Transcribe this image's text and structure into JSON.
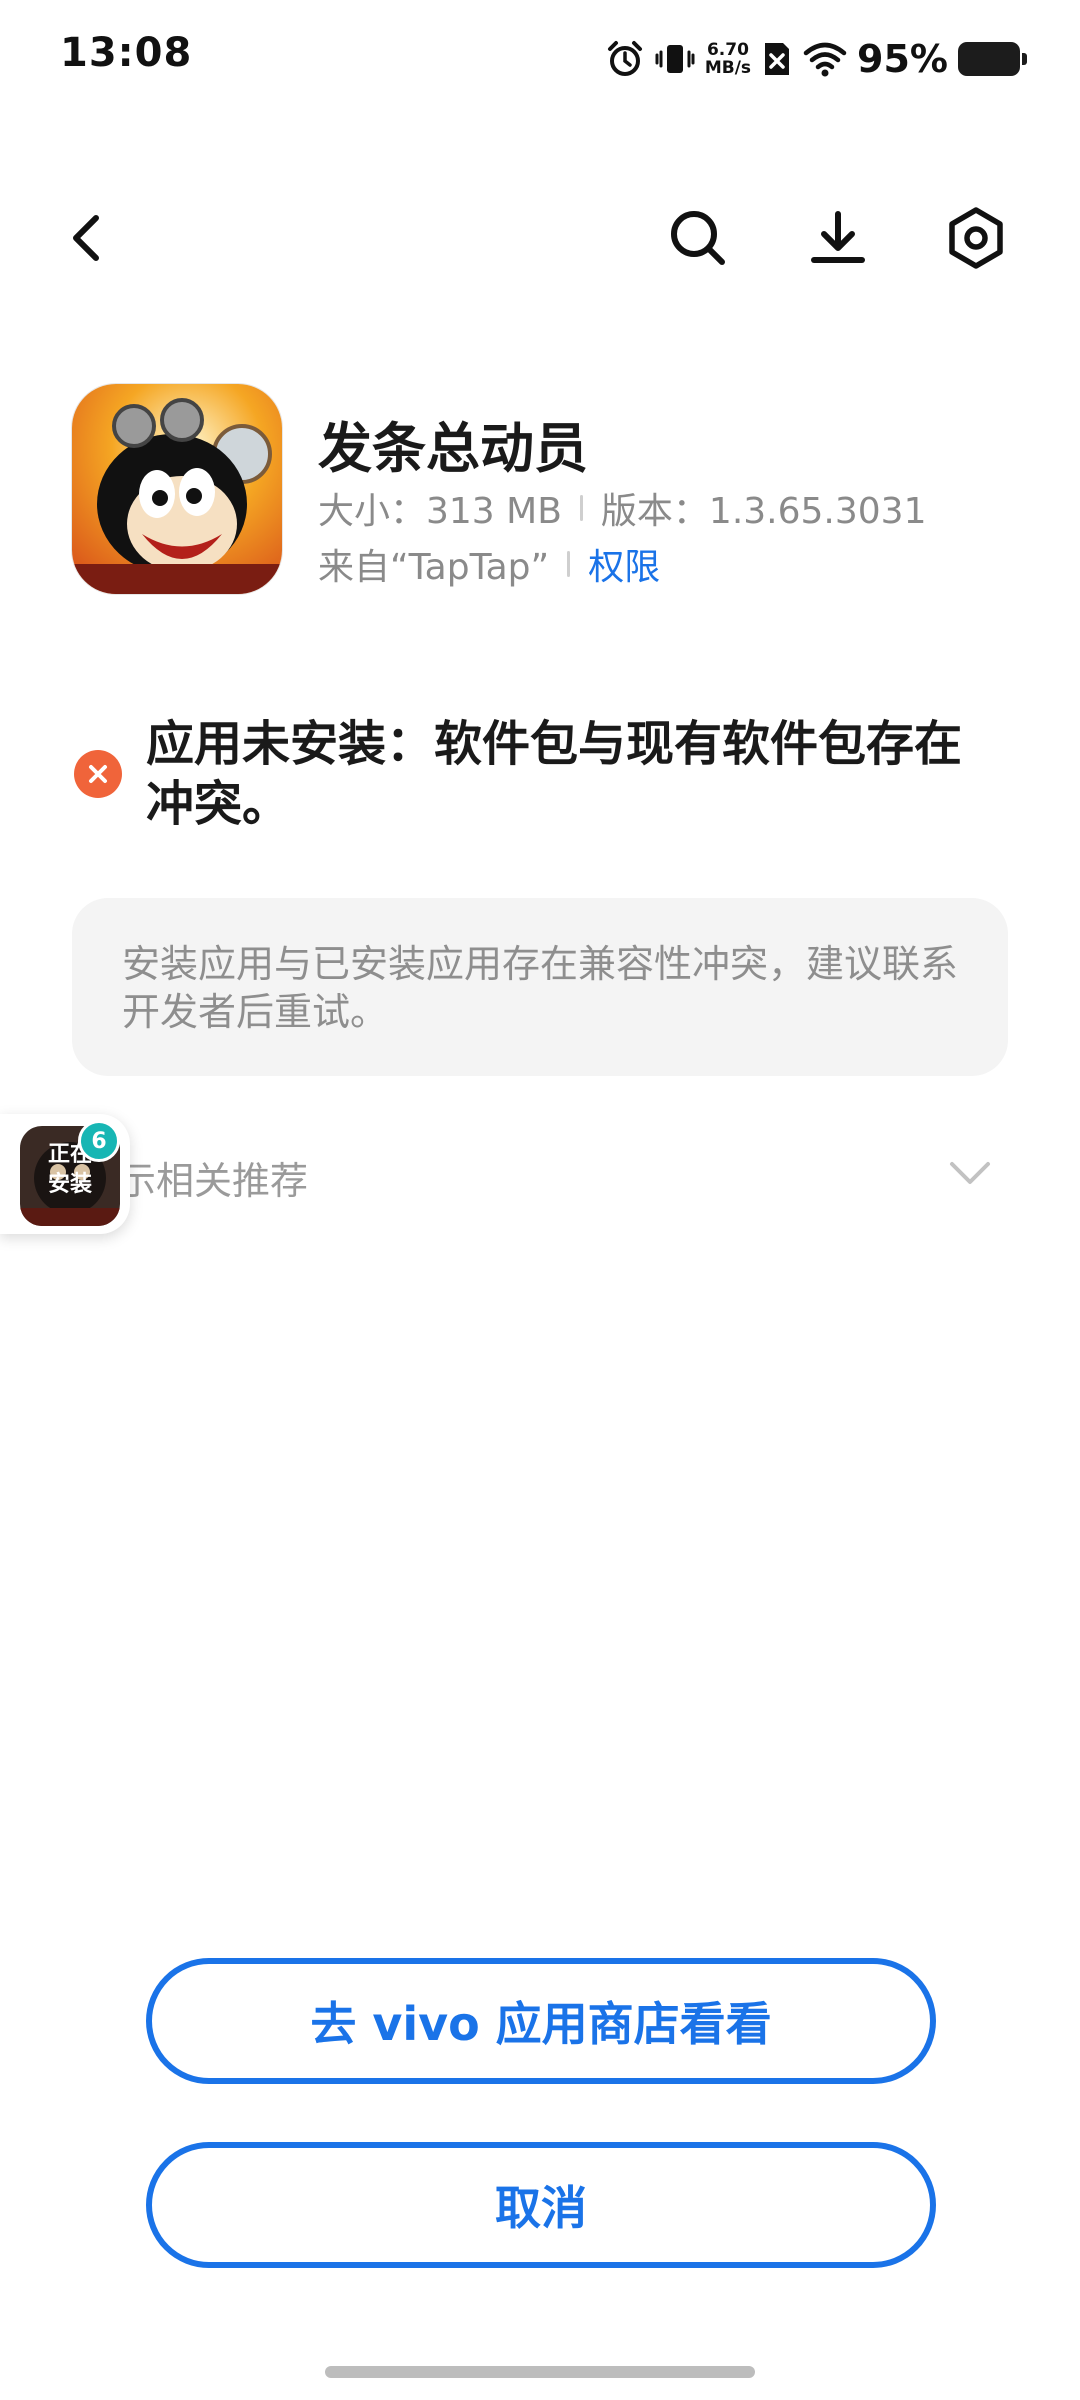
{
  "status_bar": {
    "time": "13:08",
    "net_speed_value": "6.70",
    "net_speed_unit": "MB/s",
    "battery_percent": "95%",
    "icons": [
      "alarm-icon",
      "vibrate-icon",
      "no-sim-icon",
      "wifi-icon",
      "battery-icon"
    ]
  },
  "top_bar": {
    "icons": [
      "back-arrow-icon",
      "search-icon",
      "download-icon",
      "settings-icon"
    ]
  },
  "app": {
    "name": "发条总动员",
    "size": "大小：313 MB",
    "version": "版本：1.3.65.3031",
    "source": "来自“TapTap”",
    "permissions_link": "权限"
  },
  "error": {
    "message": "应用未安装：软件包与现有软件包存在冲突。",
    "hint": "安装应用与已安装应用存在兼容性冲突，建议联系开发者后重试。"
  },
  "recommendations": {
    "label": "示相关推荐"
  },
  "floating_widget": {
    "label_line1": "正在",
    "label_line2": "安装",
    "badge": "6"
  },
  "buttons": {
    "store": "去 vivo 应用商店看看",
    "cancel": "取消"
  },
  "colors": {
    "accent": "#1a73e8",
    "error": "#f0643a",
    "badge": "#17b6b4"
  }
}
